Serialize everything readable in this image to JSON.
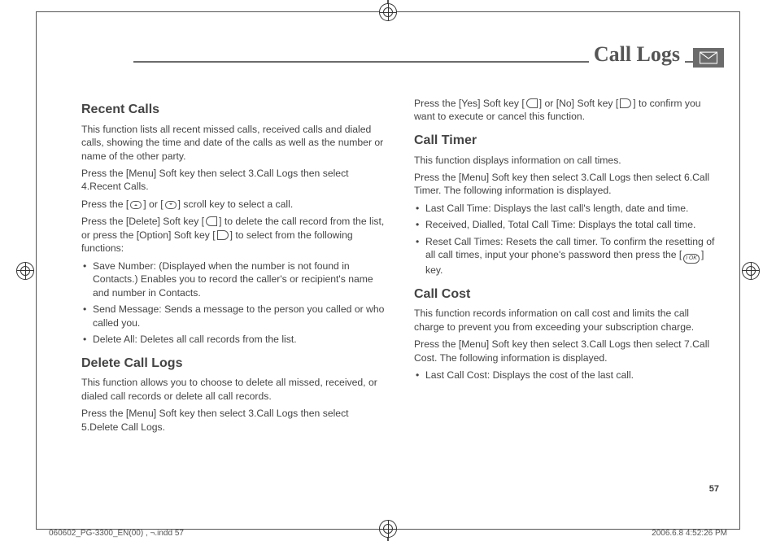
{
  "header": {
    "title": "Call Logs"
  },
  "page_number": "57",
  "footer": {
    "left": "060602_PG-3300_EN(00) , ¬.indd   57",
    "right": "2006.6.8   4:52:26 PM"
  },
  "left_col": {
    "recent_heading": "Recent Calls",
    "recent_p1": "This function lists all recent missed calls, received calls and dialed calls, showing the time and date of the calls as well as the number or name of the other party.",
    "recent_p2": "Press the [Menu] Soft key then select 3.Call Logs then select 4.Recent Calls.",
    "recent_p3a": "Press the [",
    "recent_p3b": "] or [",
    "recent_p3c": "] scroll key to select a call.",
    "recent_p4a": "Press the [Delete] Soft key [",
    "recent_p4b": "] to delete the call record from the list, or press the [Option] Soft key [",
    "recent_p4c": "] to select from the following functions:",
    "recent_li1": "Save Number: (Displayed when the number is not found in Contacts.) Enables you to record the caller's or recipient's name and number in Contacts.",
    "recent_li2": "Send Message: Sends a message to the person you called or who called you.",
    "recent_li3": "Delete All: Deletes all call records from the list.",
    "delete_heading": "Delete Call Logs",
    "delete_p1": "This function allows you to choose to delete all missed, received, or dialed call records or delete all call records.",
    "delete_p2": "Press the [Menu] Soft key then select 3.Call Logs then select 5.Delete Call Logs."
  },
  "right_col": {
    "delete_p3a": "Press the [Yes] Soft key [",
    "delete_p3b": "] or [No] Soft key [",
    "delete_p3c": "] to confirm you want to execute or cancel this function.",
    "timer_heading": "Call Timer",
    "timer_p1": "This function displays information on call times.",
    "timer_p2": "Press the [Menu] Soft key then select 3.Call Logs then select 6.Call Timer. The following information is displayed.",
    "timer_li1": "Last Call Time: Displays the last call's length, date and time.",
    "timer_li2": "Received, Dialled, Total Call Time: Displays the total call time.",
    "timer_li3a": "Reset Call Times: Resets the call timer. To confirm the resetting of all call times, input your phone's password then press the [",
    "timer_li3b": "] key.",
    "cost_heading": "Call Cost",
    "cost_p1": "This function records information on call cost and limits the call charge to prevent you from exceeding your subscription charge.",
    "cost_p2": "Press the [Menu] Soft key then select 3.Call Logs then select 7.Call Cost. The following information is displayed.",
    "cost_li1": "Last Call Cost: Displays the cost of the last call."
  }
}
